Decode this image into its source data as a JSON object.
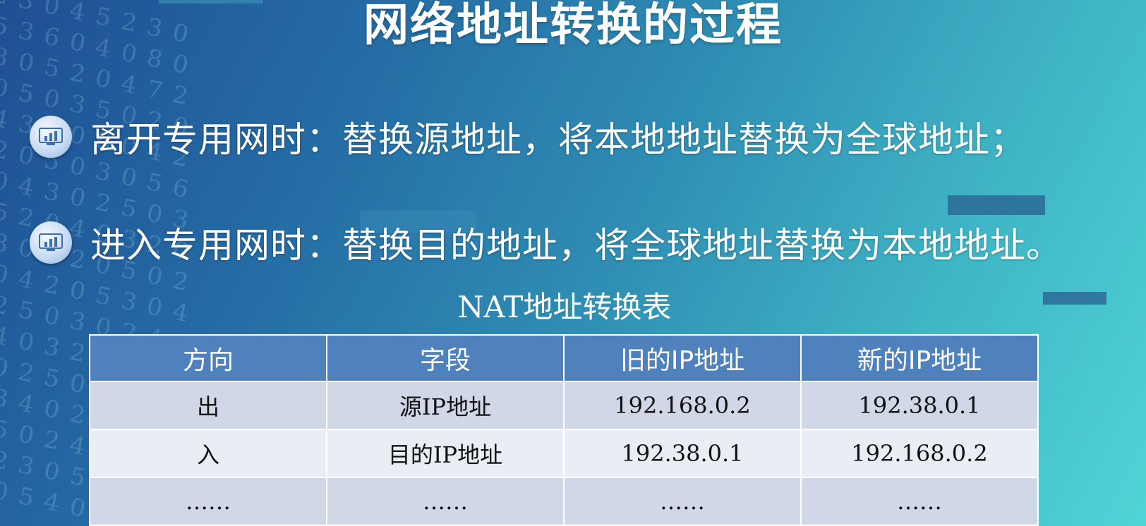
{
  "title": "网络地址转换的过程",
  "bullets": [
    {
      "icon": "chart-icon",
      "text": "离开专用网时：替换源地址，将本地地址替换为全球地址；"
    },
    {
      "icon": "chart-icon",
      "text": "进入专用网时：替换目的地址，将全球地址替换为本地地址。"
    }
  ],
  "table": {
    "caption": "NAT地址转换表",
    "headers": [
      "方向",
      "字段",
      "旧的IP地址",
      "新的IP地址"
    ],
    "rows": [
      [
        "出",
        "源IP地址",
        "192.168.0.2",
        "192.38.0.1"
      ],
      [
        "入",
        "目的IP地址",
        "192.38.0.1",
        "192.168.0.2"
      ],
      [
        "……",
        "……",
        "……",
        "……"
      ]
    ]
  },
  "colors": {
    "header_bg": "#4f81bd",
    "row_odd_bg": "#d0d8e8",
    "row_even_bg": "#e9edf4",
    "text_light": "#ffffff"
  }
}
